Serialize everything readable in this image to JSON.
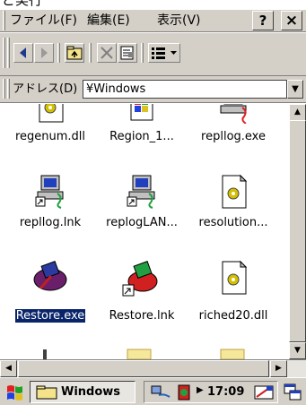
{
  "window": {
    "caption_partial": "ど実行"
  },
  "menubar": {
    "items": [
      {
        "label": "ファイル(F)"
      },
      {
        "label": "編集(E)"
      },
      {
        "label": "表示(V)"
      }
    ],
    "help_label": "?",
    "close_label": "×"
  },
  "toolbar": {
    "buttons": [
      "back-icon",
      "forward-icon",
      "up-folder-icon",
      "delete-icon",
      "properties-icon",
      "view-menu-icon"
    ]
  },
  "address": {
    "label": "アドレス(D)",
    "value": "¥Windows"
  },
  "files": [
    {
      "name": "regenum.dll",
      "icon": "dll-gear-icon",
      "selected": false
    },
    {
      "name": "Region_1...",
      "icon": "control-panel-icon",
      "selected": false
    },
    {
      "name": "repllog.exe",
      "icon": "network-computer-icon",
      "selected": false
    },
    {
      "name": "repllog.lnk",
      "icon": "computer-shortcut-icon",
      "selected": false
    },
    {
      "name": "replogLAN...",
      "icon": "computer-shortcut-icon",
      "selected": false
    },
    {
      "name": "resolution...",
      "icon": "dll-gear-icon",
      "selected": false
    },
    {
      "name": "Restore.exe",
      "icon": "restore-app-icon",
      "selected": true
    },
    {
      "name": "Restore.lnk",
      "icon": "restore-shortcut-icon",
      "selected": false
    },
    {
      "name": "riched20.dll",
      "icon": "dll-gear-icon",
      "selected": false
    }
  ],
  "taskbar": {
    "start_icon": "windows-flag-icon",
    "task_label": "Windows",
    "clock": "17:09"
  },
  "colors": {
    "chrome": "#d4d0c8",
    "selection": "#0a246a",
    "background": "#ffffff"
  }
}
